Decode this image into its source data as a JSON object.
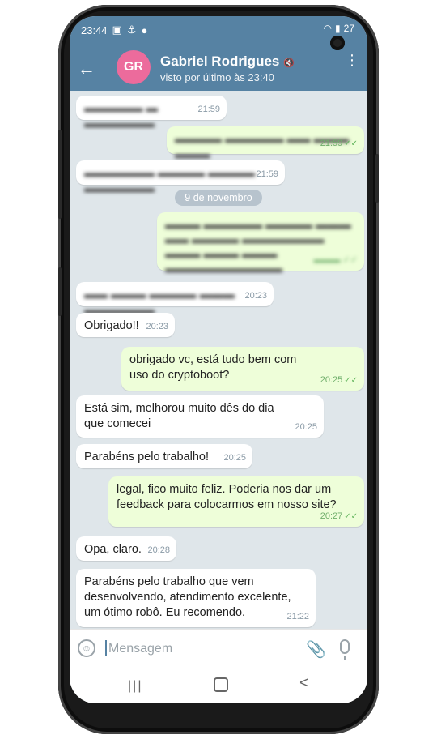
{
  "status": {
    "time": "23:44",
    "battery": "27"
  },
  "header": {
    "avatar_initials": "GR",
    "name": "Gabriel Rodrigues",
    "last_seen": "visto por último às 23:40",
    "back_glyph": "←",
    "menu_glyph": "⋮",
    "mute_glyph": "🔇"
  },
  "date_separator": "9 de novembro",
  "messages": [
    {
      "dir": "in",
      "text": "",
      "time": "21:59",
      "blurred": true
    },
    {
      "dir": "out",
      "text": "",
      "time": "21:59",
      "blurred": true
    },
    {
      "dir": "in",
      "text": "",
      "time": "21:59",
      "blurred": true
    },
    {
      "dir": "out",
      "text": "",
      "time": "",
      "blurred": true
    },
    {
      "dir": "in",
      "text": "",
      "time": "20:23",
      "blurred": true
    },
    {
      "dir": "in",
      "text": "Obrigado!!",
      "time": "20:23"
    },
    {
      "dir": "out",
      "text": "obrigado vc, está tudo bem com uso do cryptoboot?",
      "time": "20:25"
    },
    {
      "dir": "in",
      "text": "Está sim, melhorou muito dês do dia que comecei",
      "time": "20:25"
    },
    {
      "dir": "in",
      "text": "Parabéns pelo trabalho!",
      "time": "20:25"
    },
    {
      "dir": "out",
      "text": "legal, fico muito feliz. Poderia nos dar um feedback para colocarmos em nosso site?",
      "time": "20:27"
    },
    {
      "dir": "in",
      "text": "Opa, claro.",
      "time": "20:28"
    },
    {
      "dir": "in",
      "text": "Parabéns pelo trabalho que vem desenvolvendo, atendimento excelente, um ótimo robô. Eu recomendo.",
      "time": "21:22"
    }
  ],
  "input": {
    "placeholder": "Mensagem"
  },
  "colors": {
    "header": "#5682a3",
    "avatar": "#ec6b9c",
    "outgoing_bubble": "#eefed9",
    "incoming_bubble": "#ffffff",
    "chat_bg": "#dfe6ea"
  },
  "icons": {
    "emoji": "emoji-icon",
    "attach": "paperclip-icon",
    "mic": "microphone-icon"
  }
}
